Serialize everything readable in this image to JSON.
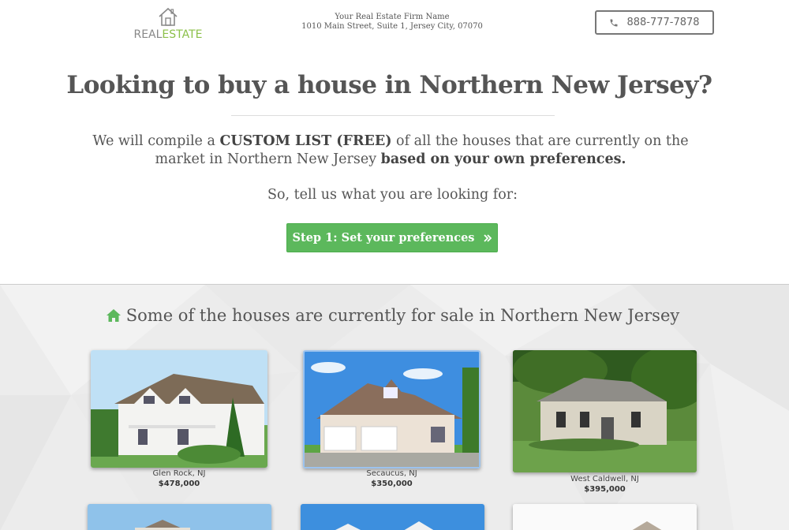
{
  "header": {
    "logo": {
      "real": "REAL",
      "estate": "ESTATE",
      "icon": "house-outline-icon"
    },
    "firm_name": "Your Real Estate Firm Name",
    "firm_address": "1010 Main Street, Suite 1, Jersey City, 07070",
    "phone": "888-777-7878",
    "phone_icon": "phone-icon"
  },
  "hero": {
    "title": "Looking to buy a house in Northern New Jersey?",
    "text_1": "We will compile a ",
    "text_bold_1": "CUSTOM LIST (FREE)",
    "text_2": " of all the houses that are currently on the market in Northern New Jersey ",
    "text_bold_2": "based on your own preferences.",
    "ask": "So, tell us what you are looking for:",
    "cta_label": "Step 1: Set your preferences",
    "cta_icon": "double-chevron-right-icon"
  },
  "listings": {
    "title": "Some of the houses are currently for sale in Northern New Jersey",
    "title_icon": "home-icon",
    "items": [
      {
        "location": "Glen Rock, NJ",
        "price": "$478,000"
      },
      {
        "location": "Secaucus, NJ",
        "price": "$350,000"
      },
      {
        "location": "West Caldwell, NJ",
        "price": "$395,000"
      }
    ]
  },
  "colors": {
    "accent_green": "#5cb85c",
    "logo_green": "#8cc04a",
    "text": "#555555",
    "section_bg": "#eeeeee"
  }
}
